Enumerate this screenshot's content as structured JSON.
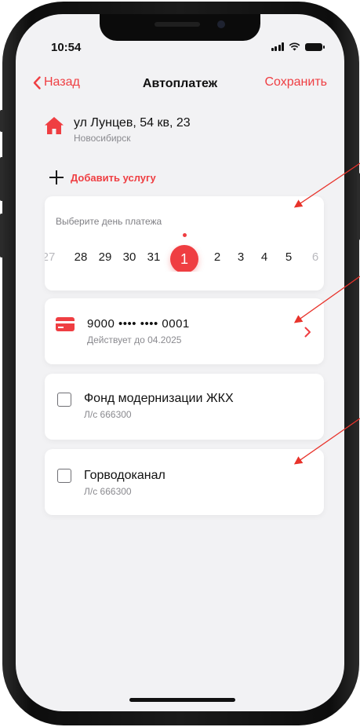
{
  "status_bar": {
    "time": "10:54"
  },
  "nav": {
    "back_label": "Назад",
    "title": "Автоплатеж",
    "save_label": "Сохранить"
  },
  "address": {
    "street": "ул Лунцев, 54 кв, 23",
    "city": "Новосибирск"
  },
  "add_service": {
    "label": "Добавить услугу"
  },
  "payment_day": {
    "label": "Выберите день платежа",
    "days": [
      "27",
      "28",
      "29",
      "30",
      "31",
      "1",
      "2",
      "3",
      "4",
      "5",
      "6"
    ],
    "selected": "1"
  },
  "payment_card": {
    "number": "9000 •••• •••• 0001",
    "valid_until": "Действует до 04.2025"
  },
  "services": [
    {
      "name": "Фонд модернизации ЖКХ",
      "account": "Л/с 666300"
    },
    {
      "name": "Горводоканал",
      "account": "Л/с 666300"
    }
  ],
  "colors": {
    "accent": "#ef3e42",
    "background": "#f2f2f4",
    "card": "#ffffff",
    "annotation": "#e8332b"
  }
}
